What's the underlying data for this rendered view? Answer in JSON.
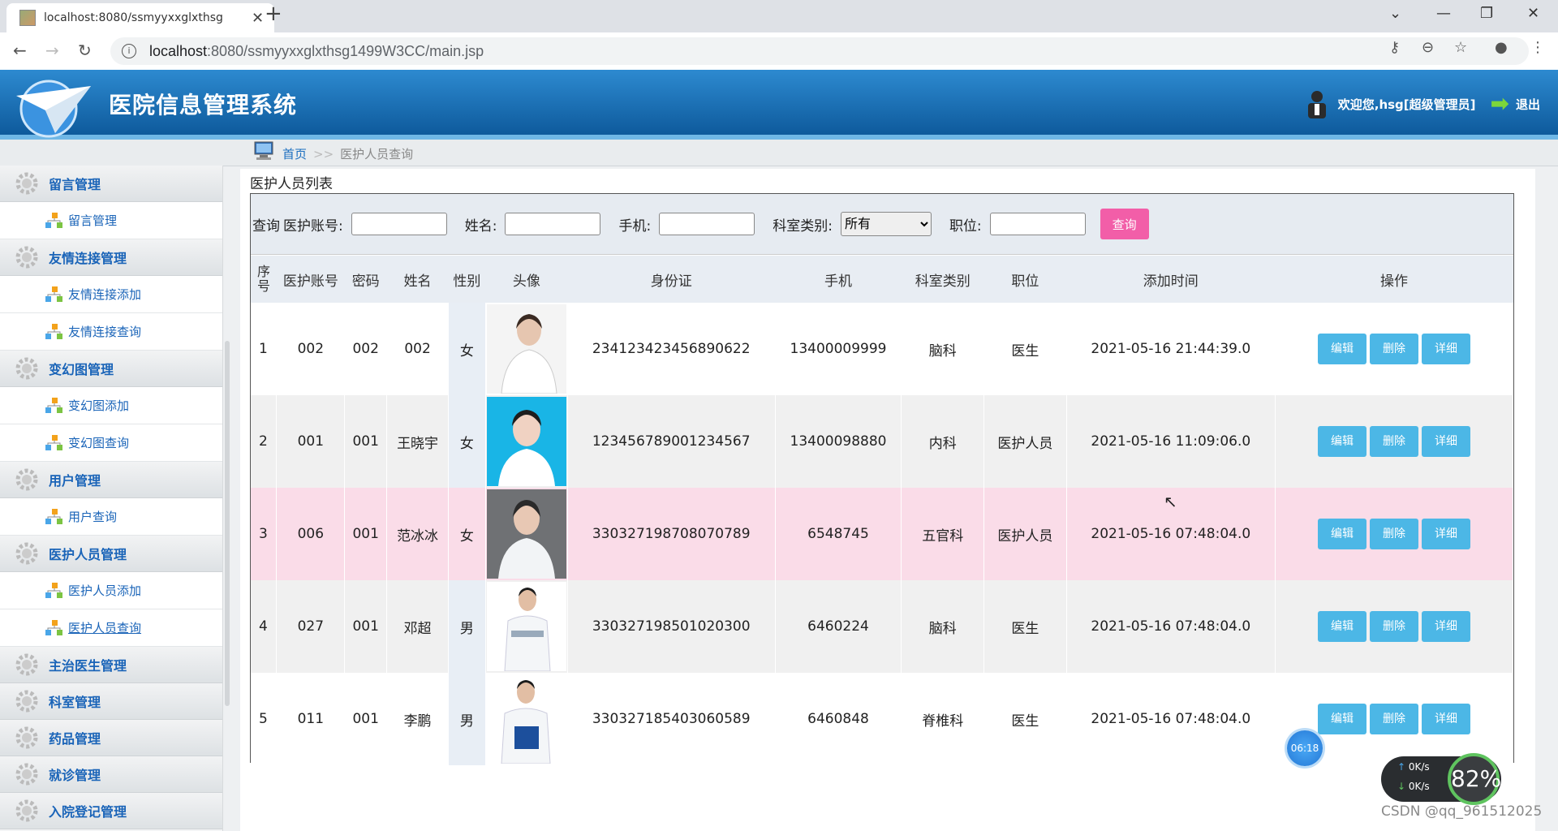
{
  "browser": {
    "tab_title": "localhost:8080/ssmyyxxglxthsg",
    "url_host": "localhost",
    "url_rest": ":8080/ssmyyxxglxthsg1499W3CC/main.jsp"
  },
  "header": {
    "title": "医院信息管理系统",
    "welcome": "欢迎您,hsg[超级管理员]",
    "logout": "退出"
  },
  "breadcrumb": {
    "home": "首页",
    "sep": ">>",
    "current": "医护人员查询"
  },
  "sidebar": {
    "g_msg": "留言管理",
    "i_msg": "留言管理",
    "g_link": "友情连接管理",
    "i_link_add": "友情连接添加",
    "i_link_query": "友情连接查询",
    "g_slide": "变幻图管理",
    "i_slide_add": "变幻图添加",
    "i_slide_query": "变幻图查询",
    "g_user": "用户管理",
    "i_user_query": "用户查询",
    "g_staff": "医护人员管理",
    "i_staff_add": "医护人员添加",
    "i_staff_query": "医护人员查询",
    "g_doctor": "主治医生管理",
    "g_dept": "科室管理",
    "g_drug": "药品管理",
    "g_visit": "就诊管理",
    "g_admit": "入院登记管理"
  },
  "main": {
    "panel_title": "医护人员列表",
    "search": {
      "query_label": "查询",
      "account_label": "医护账号:",
      "name_label": "姓名:",
      "phone_label": "手机:",
      "dept_label": "科室类别:",
      "dept_value": "所有",
      "position_label": "职位:",
      "button": "查询"
    },
    "columns": [
      "序号",
      "医护账号",
      "密码",
      "姓名",
      "性别",
      "头像",
      "身份证",
      "手机",
      "科室类别",
      "职位",
      "添加时间",
      "操作"
    ],
    "actions": {
      "edit": "编辑",
      "delete": "删除",
      "detail": "详细"
    },
    "rows": [
      {
        "no": "1",
        "account": "002",
        "pwd": "002",
        "name": "002",
        "sex": "女",
        "id": "234123423456890622",
        "phone": "13400009999",
        "dept": "脑科",
        "pos": "医生",
        "time": "2021-05-16 21:44:39.0"
      },
      {
        "no": "2",
        "account": "001",
        "pwd": "001",
        "name": "王晓宇",
        "sex": "女",
        "id": "123456789001234567",
        "phone": "13400098880",
        "dept": "内科",
        "pos": "医护人员",
        "time": "2021-05-16 11:09:06.0"
      },
      {
        "no": "3",
        "account": "006",
        "pwd": "001",
        "name": "范冰冰",
        "sex": "女",
        "id": "330327198708070789",
        "phone": "6548745",
        "dept": "五官科",
        "pos": "医护人员",
        "time": "2021-05-16 07:48:04.0"
      },
      {
        "no": "4",
        "account": "027",
        "pwd": "001",
        "name": "邓超",
        "sex": "男",
        "id": "330327198501020300",
        "phone": "6460224",
        "dept": "脑科",
        "pos": "医生",
        "time": "2021-05-16 07:48:04.0"
      },
      {
        "no": "5",
        "account": "011",
        "pwd": "001",
        "name": "李鹏",
        "sex": "男",
        "id": "330327185403060589",
        "phone": "6460848",
        "dept": "脊椎科",
        "pos": "医生",
        "time": "2021-05-16 07:48:04.0"
      }
    ]
  },
  "overlays": {
    "timer": "06:18",
    "net_up": "0K/s",
    "net_down": "0K/s",
    "cpu": "82%",
    "watermark": "CSDN @qq_961512025"
  },
  "colors": {
    "header_blue": "#1a6fb5",
    "query_pink": "#f25ea8",
    "action_blue": "#4cb7e6",
    "highlight_row": "#fadce8"
  }
}
